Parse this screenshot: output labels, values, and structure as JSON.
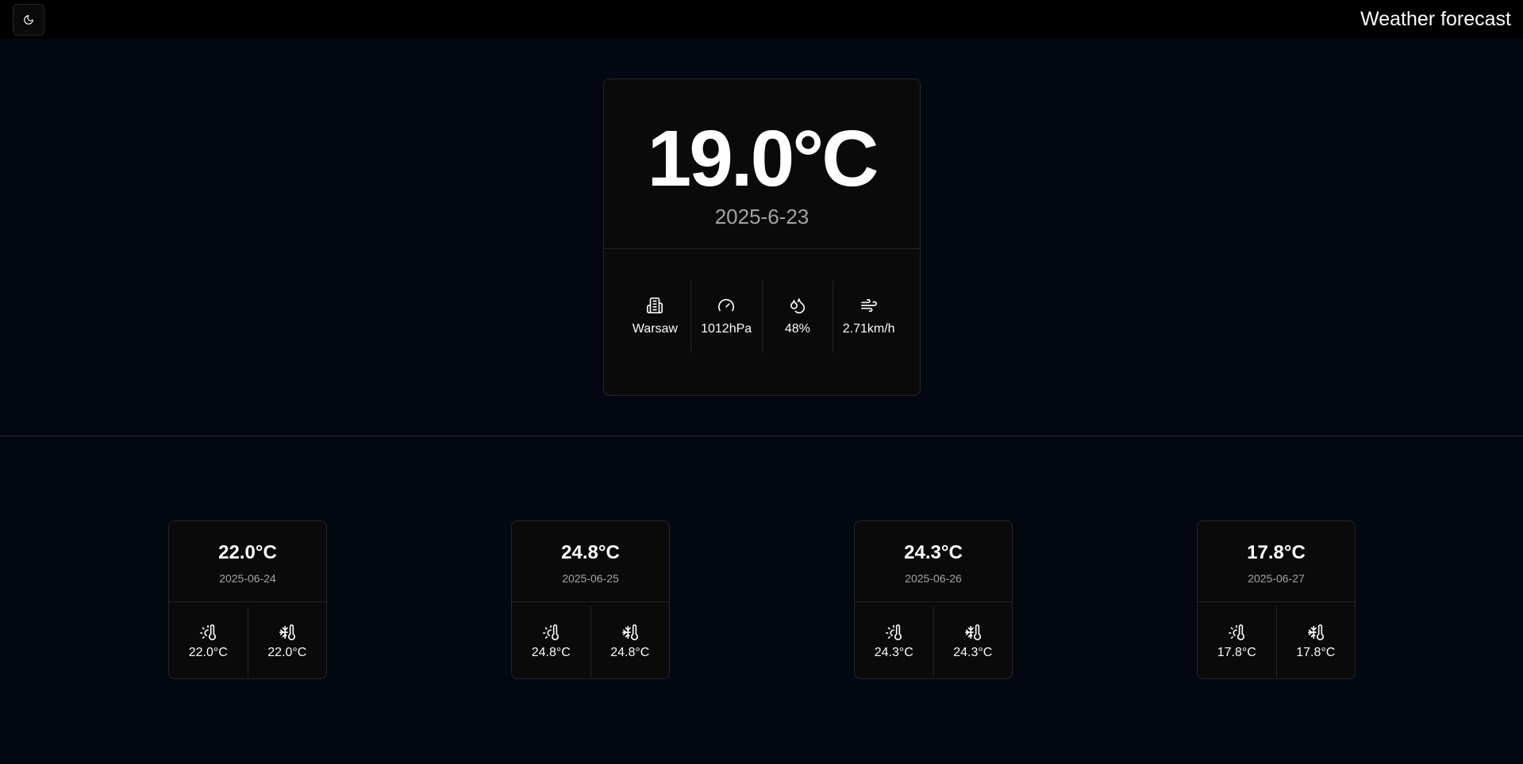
{
  "header": {
    "title": "Weather forecast",
    "theme_icon": "moon-icon"
  },
  "current": {
    "temperature": "19.0°C",
    "date": "2025-6-23",
    "city": "Warsaw",
    "pressure": "1012hPa",
    "humidity": "48%",
    "wind": "2.71km/h",
    "icons": {
      "city": "building-icon",
      "pressure": "gauge-icon",
      "humidity": "droplets-icon",
      "wind": "wind-icon"
    }
  },
  "forecast": [
    {
      "temperature": "22.0°C",
      "date": "2025-06-24",
      "max": "22.0°C",
      "min": "22.0°C"
    },
    {
      "temperature": "24.8°C",
      "date": "2025-06-25",
      "max": "24.8°C",
      "min": "24.8°C"
    },
    {
      "temperature": "24.3°C",
      "date": "2025-06-26",
      "max": "24.3°C",
      "min": "24.3°C"
    },
    {
      "temperature": "17.8°C",
      "date": "2025-06-27",
      "max": "17.8°C",
      "min": "17.8°C"
    }
  ],
  "forecast_icons": {
    "max": "thermometer-sun-icon",
    "min": "thermometer-snowflake-icon"
  },
  "colors": {
    "background": "#030712",
    "card": "#0a0a0a",
    "border": "#262626",
    "muted_text": "#a3a3a3"
  }
}
